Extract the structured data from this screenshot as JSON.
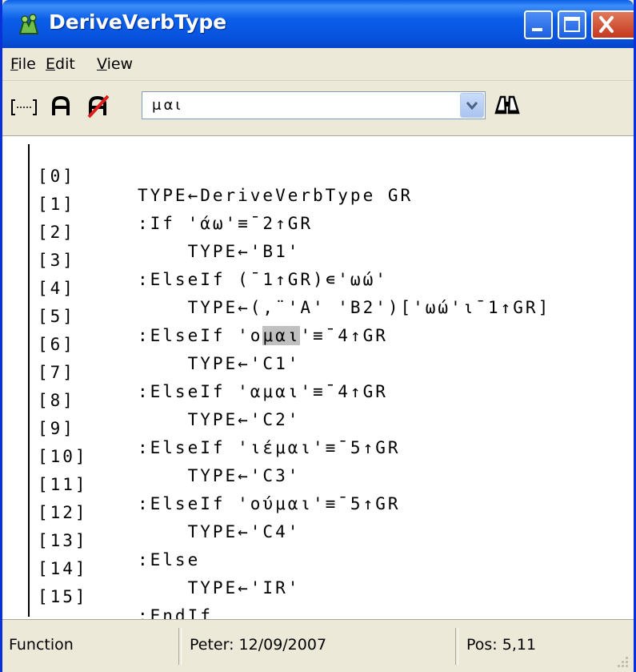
{
  "window": {
    "title": "DeriveVerbType",
    "icons": {
      "app": "function-icon",
      "minimize": "minimize-icon",
      "maximize": "maximize-icon",
      "close": "close-icon"
    }
  },
  "menu": {
    "items": [
      {
        "label": "File",
        "underline": "F",
        "rest": "ile"
      },
      {
        "label": "Edit",
        "underline": "E",
        "rest": "dit"
      },
      {
        "label": "View",
        "underline": "V",
        "rest": "iew"
      }
    ]
  },
  "toolbar": {
    "icons": [
      "bracket-toggle-icon",
      "search-case-icon",
      "search-case-off-icon",
      "binoculars-icon"
    ],
    "search": {
      "value": "μαι"
    }
  },
  "code": {
    "lines": [
      {
        "num": "[0]",
        "code": "TYPE←DeriveVerbType GR"
      },
      {
        "num": "[1]",
        "code": ":If 'άω'≡¯2↑GR"
      },
      {
        "num": "[2]",
        "code": "    TYPE←'B1'"
      },
      {
        "num": "[3]",
        "code": ":ElseIf (¯1↑GR)∊'ωώ'"
      },
      {
        "num": "[4]",
        "code": "    TYPE←(,¨'A' 'B2')['ωώ'⍳¯1↑GR]"
      },
      {
        "num": "[5]",
        "code_before": ":ElseIf 'o",
        "code_highlight": "μαι",
        "code_after": "'≡¯4↑GR"
      },
      {
        "num": "[6]",
        "code": "    TYPE←'C1'"
      },
      {
        "num": "[7]",
        "code": ":ElseIf 'αμαι'≡¯4↑GR"
      },
      {
        "num": "[8]",
        "code": "    TYPE←'C2'"
      },
      {
        "num": "[9]",
        "code": ":ElseIf 'ιέμαι'≡¯5↑GR"
      },
      {
        "num": "[10]",
        "code": "    TYPE←'C3'"
      },
      {
        "num": "[11]",
        "code": ":ElseIf 'oύμαι'≡¯5↑GR"
      },
      {
        "num": "[12]",
        "code": "    TYPE←'C4'"
      },
      {
        "num": "[13]",
        "code": ":Else"
      },
      {
        "num": "[14]",
        "code": "    TYPE←'IR'"
      },
      {
        "num": "[15]",
        "code": ":EndIf"
      }
    ]
  },
  "status": {
    "type": "Function",
    "author": "Peter: 12/09/2007",
    "position": "Pos: 5,11"
  }
}
